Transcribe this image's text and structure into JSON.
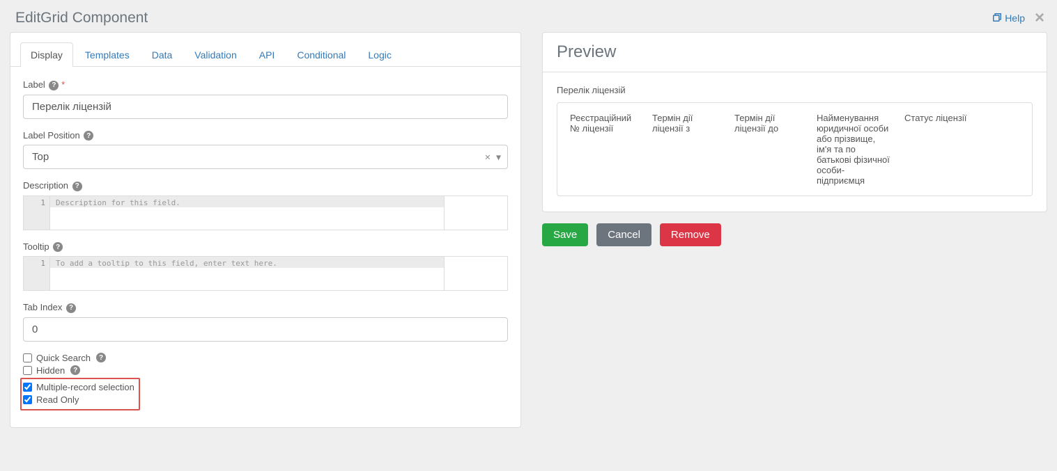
{
  "modal": {
    "title": "EditGrid Component",
    "help_label": "Help"
  },
  "tabs": [
    {
      "label": "Display"
    },
    {
      "label": "Templates"
    },
    {
      "label": "Data"
    },
    {
      "label": "Validation"
    },
    {
      "label": "API"
    },
    {
      "label": "Conditional"
    },
    {
      "label": "Logic"
    }
  ],
  "form": {
    "label_field": {
      "label": "Label",
      "value": "Перелік ліцензій"
    },
    "label_position": {
      "label": "Label Position",
      "value": "Top"
    },
    "description": {
      "label": "Description",
      "placeholder": "Description for this field."
    },
    "tooltip": {
      "label": "Tooltip",
      "placeholder": "To add a tooltip to this field, enter text here."
    },
    "tab_index": {
      "label": "Tab Index",
      "value": "0"
    },
    "checkboxes": {
      "quick_search": "Quick Search",
      "hidden": "Hidden",
      "multi_select": "Multiple-record selection",
      "read_only": "Read Only"
    },
    "gutter_line": "1"
  },
  "preview": {
    "title": "Preview",
    "grid_label": "Перелік ліцензій",
    "columns": [
      "Реєстраційний № ліцензії",
      "Термін дії ліцензії з",
      "Термін дії ліцензії до",
      "Найменування юридичної особи або прізвище, ім'я та по батькові фізичної особи-підприємця",
      "Статус ліцензії"
    ],
    "buttons": {
      "save": "Save",
      "cancel": "Cancel",
      "remove": "Remove"
    }
  }
}
